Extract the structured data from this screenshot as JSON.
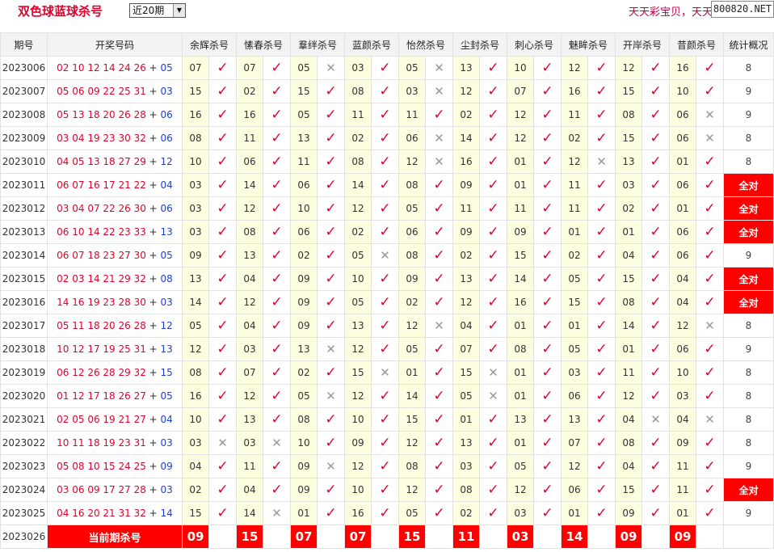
{
  "header": {
    "title": "双色球蓝球杀号",
    "period_select": "近20期",
    "promo_text": "天天彩宝贝，天天",
    "site_badge": "800820.NET"
  },
  "columns": {
    "issue": "期号",
    "draw": "开奖号码",
    "experts": [
      "余辉杀号",
      "愫春杀号",
      "羣绊杀号",
      "蓝颜杀号",
      "怡然杀号",
      "尘封杀号",
      "刺心杀号",
      "魅眸杀号",
      "开岸杀号",
      "昔颜杀号"
    ],
    "summary": "统计概况"
  },
  "rows": [
    {
      "issue": "2023006",
      "reds": "02 10 12 14 24 26",
      "blue": "05",
      "picks": [
        [
          "07",
          1
        ],
        [
          "07",
          1
        ],
        [
          "05",
          0
        ],
        [
          "03",
          1
        ],
        [
          "05",
          0
        ],
        [
          "13",
          1
        ],
        [
          "10",
          1
        ],
        [
          "12",
          1
        ],
        [
          "12",
          1
        ],
        [
          "16",
          1
        ]
      ],
      "stat": "8"
    },
    {
      "issue": "2023007",
      "reds": "05 06 09 22 25 31",
      "blue": "03",
      "picks": [
        [
          "15",
          1
        ],
        [
          "02",
          1
        ],
        [
          "15",
          1
        ],
        [
          "08",
          1
        ],
        [
          "03",
          0
        ],
        [
          "12",
          1
        ],
        [
          "07",
          1
        ],
        [
          "16",
          1
        ],
        [
          "15",
          1
        ],
        [
          "10",
          1
        ]
      ],
      "stat": "9"
    },
    {
      "issue": "2023008",
      "reds": "05 13 18 20 26 28",
      "blue": "06",
      "picks": [
        [
          "16",
          1
        ],
        [
          "16",
          1
        ],
        [
          "05",
          1
        ],
        [
          "11",
          1
        ],
        [
          "11",
          1
        ],
        [
          "02",
          1
        ],
        [
          "12",
          1
        ],
        [
          "11",
          1
        ],
        [
          "08",
          1
        ],
        [
          "06",
          0
        ]
      ],
      "stat": "9"
    },
    {
      "issue": "2023009",
      "reds": "03 04 19 23 30 32",
      "blue": "06",
      "picks": [
        [
          "08",
          1
        ],
        [
          "11",
          1
        ],
        [
          "13",
          1
        ],
        [
          "02",
          1
        ],
        [
          "06",
          0
        ],
        [
          "14",
          1
        ],
        [
          "12",
          1
        ],
        [
          "02",
          1
        ],
        [
          "15",
          1
        ],
        [
          "06",
          0
        ]
      ],
      "stat": "8"
    },
    {
      "issue": "2023010",
      "reds": "04 05 13 18 27 29",
      "blue": "12",
      "picks": [
        [
          "10",
          1
        ],
        [
          "06",
          1
        ],
        [
          "11",
          1
        ],
        [
          "08",
          1
        ],
        [
          "12",
          0
        ],
        [
          "16",
          1
        ],
        [
          "01",
          1
        ],
        [
          "12",
          0
        ],
        [
          "13",
          1
        ],
        [
          "01",
          1
        ]
      ],
      "stat": "8"
    },
    {
      "issue": "2023011",
      "reds": "06 07 16 17 21 22",
      "blue": "04",
      "picks": [
        [
          "03",
          1
        ],
        [
          "14",
          1
        ],
        [
          "06",
          1
        ],
        [
          "14",
          1
        ],
        [
          "08",
          1
        ],
        [
          "09",
          1
        ],
        [
          "01",
          1
        ],
        [
          "11",
          1
        ],
        [
          "03",
          1
        ],
        [
          "06",
          1
        ]
      ],
      "stat": "全对"
    },
    {
      "issue": "2023012",
      "reds": "03 04 07 22 26 30",
      "blue": "06",
      "picks": [
        [
          "03",
          1
        ],
        [
          "12",
          1
        ],
        [
          "10",
          1
        ],
        [
          "12",
          1
        ],
        [
          "05",
          1
        ],
        [
          "11",
          1
        ],
        [
          "11",
          1
        ],
        [
          "11",
          1
        ],
        [
          "02",
          1
        ],
        [
          "01",
          1
        ]
      ],
      "stat": "全对"
    },
    {
      "issue": "2023013",
      "reds": "06 10 14 22 23 33",
      "blue": "13",
      "picks": [
        [
          "03",
          1
        ],
        [
          "08",
          1
        ],
        [
          "06",
          1
        ],
        [
          "02",
          1
        ],
        [
          "06",
          1
        ],
        [
          "09",
          1
        ],
        [
          "09",
          1
        ],
        [
          "01",
          1
        ],
        [
          "01",
          1
        ],
        [
          "06",
          1
        ]
      ],
      "stat": "全对"
    },
    {
      "issue": "2023014",
      "reds": "06 07 18 23 27 30",
      "blue": "05",
      "picks": [
        [
          "09",
          1
        ],
        [
          "13",
          1
        ],
        [
          "02",
          1
        ],
        [
          "05",
          0
        ],
        [
          "08",
          1
        ],
        [
          "02",
          1
        ],
        [
          "15",
          1
        ],
        [
          "02",
          1
        ],
        [
          "04",
          1
        ],
        [
          "06",
          1
        ]
      ],
      "stat": "9"
    },
    {
      "issue": "2023015",
      "reds": "02 03 14 21 29 32",
      "blue": "08",
      "picks": [
        [
          "13",
          1
        ],
        [
          "04",
          1
        ],
        [
          "09",
          1
        ],
        [
          "10",
          1
        ],
        [
          "09",
          1
        ],
        [
          "13",
          1
        ],
        [
          "14",
          1
        ],
        [
          "05",
          1
        ],
        [
          "15",
          1
        ],
        [
          "04",
          1
        ]
      ],
      "stat": "全对"
    },
    {
      "issue": "2023016",
      "reds": "14 16 19 23 28 30",
      "blue": "03",
      "picks": [
        [
          "14",
          1
        ],
        [
          "12",
          1
        ],
        [
          "09",
          1
        ],
        [
          "05",
          1
        ],
        [
          "02",
          1
        ],
        [
          "12",
          1
        ],
        [
          "16",
          1
        ],
        [
          "15",
          1
        ],
        [
          "08",
          1
        ],
        [
          "04",
          1
        ]
      ],
      "stat": "全对"
    },
    {
      "issue": "2023017",
      "reds": "05 11 18 20 26 28",
      "blue": "12",
      "picks": [
        [
          "05",
          1
        ],
        [
          "04",
          1
        ],
        [
          "09",
          1
        ],
        [
          "13",
          1
        ],
        [
          "12",
          0
        ],
        [
          "04",
          1
        ],
        [
          "01",
          1
        ],
        [
          "01",
          1
        ],
        [
          "14",
          1
        ],
        [
          "12",
          0
        ]
      ],
      "stat": "8"
    },
    {
      "issue": "2023018",
      "reds": "10 12 17 19 25 31",
      "blue": "13",
      "picks": [
        [
          "12",
          1
        ],
        [
          "03",
          1
        ],
        [
          "13",
          0
        ],
        [
          "12",
          1
        ],
        [
          "05",
          1
        ],
        [
          "07",
          1
        ],
        [
          "08",
          1
        ],
        [
          "05",
          1
        ],
        [
          "01",
          1
        ],
        [
          "06",
          1
        ]
      ],
      "stat": "9"
    },
    {
      "issue": "2023019",
      "reds": "06 12 26 28 29 32",
      "blue": "15",
      "picks": [
        [
          "08",
          1
        ],
        [
          "07",
          1
        ],
        [
          "02",
          1
        ],
        [
          "15",
          0
        ],
        [
          "01",
          1
        ],
        [
          "15",
          0
        ],
        [
          "01",
          1
        ],
        [
          "03",
          1
        ],
        [
          "11",
          1
        ],
        [
          "10",
          1
        ]
      ],
      "stat": "8"
    },
    {
      "issue": "2023020",
      "reds": "01 12 17 18 26 27",
      "blue": "05",
      "picks": [
        [
          "16",
          1
        ],
        [
          "12",
          1
        ],
        [
          "05",
          0
        ],
        [
          "12",
          1
        ],
        [
          "14",
          1
        ],
        [
          "05",
          0
        ],
        [
          "01",
          1
        ],
        [
          "06",
          1
        ],
        [
          "12",
          1
        ],
        [
          "03",
          1
        ]
      ],
      "stat": "8"
    },
    {
      "issue": "2023021",
      "reds": "02 05 06 19 21 27",
      "blue": "04",
      "picks": [
        [
          "10",
          1
        ],
        [
          "13",
          1
        ],
        [
          "08",
          1
        ],
        [
          "10",
          1
        ],
        [
          "15",
          1
        ],
        [
          "01",
          1
        ],
        [
          "13",
          1
        ],
        [
          "13",
          1
        ],
        [
          "04",
          0
        ],
        [
          "04",
          0
        ]
      ],
      "stat": "8"
    },
    {
      "issue": "2023022",
      "reds": "10 11 18 19 23 31",
      "blue": "03",
      "picks": [
        [
          "03",
          0
        ],
        [
          "03",
          0
        ],
        [
          "10",
          1
        ],
        [
          "09",
          1
        ],
        [
          "12",
          1
        ],
        [
          "13",
          1
        ],
        [
          "01",
          1
        ],
        [
          "07",
          1
        ],
        [
          "08",
          1
        ],
        [
          "09",
          1
        ]
      ],
      "stat": "8"
    },
    {
      "issue": "2023023",
      "reds": "05 08 10 15 24 25",
      "blue": "09",
      "picks": [
        [
          "04",
          1
        ],
        [
          "11",
          1
        ],
        [
          "09",
          0
        ],
        [
          "12",
          1
        ],
        [
          "08",
          1
        ],
        [
          "03",
          1
        ],
        [
          "05",
          1
        ],
        [
          "12",
          1
        ],
        [
          "04",
          1
        ],
        [
          "11",
          1
        ]
      ],
      "stat": "9"
    },
    {
      "issue": "2023024",
      "reds": "03 06 09 17 27 28",
      "blue": "03",
      "picks": [
        [
          "02",
          1
        ],
        [
          "04",
          1
        ],
        [
          "09",
          1
        ],
        [
          "10",
          1
        ],
        [
          "12",
          1
        ],
        [
          "08",
          1
        ],
        [
          "12",
          1
        ],
        [
          "06",
          1
        ],
        [
          "15",
          1
        ],
        [
          "11",
          1
        ]
      ],
      "stat": "全对"
    },
    {
      "issue": "2023025",
      "reds": "04 16 20 21 31 32",
      "blue": "14",
      "picks": [
        [
          "15",
          1
        ],
        [
          "14",
          0
        ],
        [
          "01",
          1
        ],
        [
          "16",
          1
        ],
        [
          "05",
          1
        ],
        [
          "02",
          1
        ],
        [
          "03",
          1
        ],
        [
          "01",
          1
        ],
        [
          "09",
          1
        ],
        [
          "01",
          1
        ]
      ],
      "stat": "9"
    }
  ],
  "current": {
    "issue": "2023026",
    "label": "当前期杀号",
    "picks": [
      "09",
      "15",
      "07",
      "07",
      "15",
      "11",
      "03",
      "14",
      "09",
      "09"
    ]
  },
  "symbols": {
    "hit": "✓",
    "miss": "✕",
    "stat_miss": "✕"
  },
  "colors": {
    "red": "#e4002b",
    "blue": "#1f3fd1",
    "highlight": "#ff0000",
    "pick_bg": "#fdfde0"
  }
}
